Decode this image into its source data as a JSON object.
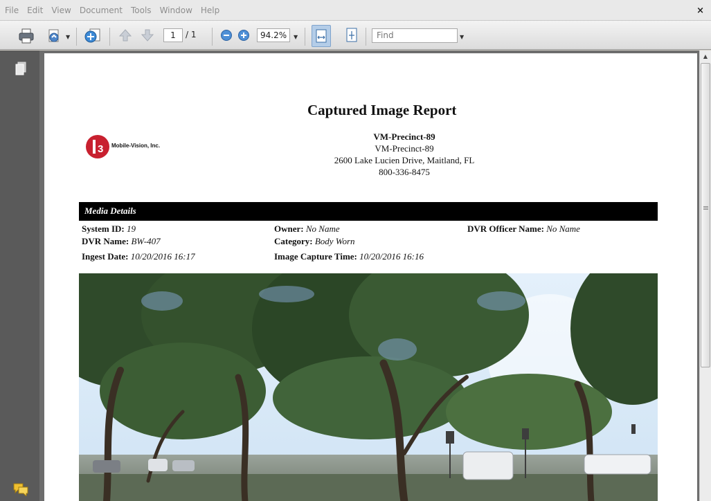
{
  "menu": [
    "File",
    "Edit",
    "View",
    "Document",
    "Tools",
    "Window",
    "Help"
  ],
  "window_close": "×",
  "toolbar": {
    "page_current": "1",
    "page_total": "/ 1",
    "zoom": "94.2%",
    "find_placeholder": "Find"
  },
  "report": {
    "title": "Captured Image Report",
    "logo_text": "Mobile-Vision, Inc.",
    "logo_mark": "L3",
    "agency_name": "VM-Precinct-89",
    "agency_sub": "VM-Precinct-89",
    "address": "2600 Lake Lucien Drive, Maitland, FL",
    "phone": "800-336-8475",
    "section_title": "Media Details",
    "fields": {
      "system_id_label": "System ID:",
      "system_id_value": "19",
      "owner_label": "Owner:",
      "owner_value": "No Name",
      "dvr_officer_label": "DVR Officer Name:",
      "dvr_officer_value": "No Name",
      "dvr_name_label": "DVR Name:",
      "dvr_name_value": "BW-407",
      "category_label": "Category:",
      "category_value": "Body Worn",
      "ingest_date_label": "Ingest Date:",
      "ingest_date_value": "10/20/2016 16:17",
      "capture_time_label": "Image Capture Time:",
      "capture_time_value": "10/20/2016 16:16"
    }
  },
  "colors": {
    "logo_red": "#c8202f",
    "section_bar": "#000000",
    "panel_dark": "#5a5a5a"
  }
}
